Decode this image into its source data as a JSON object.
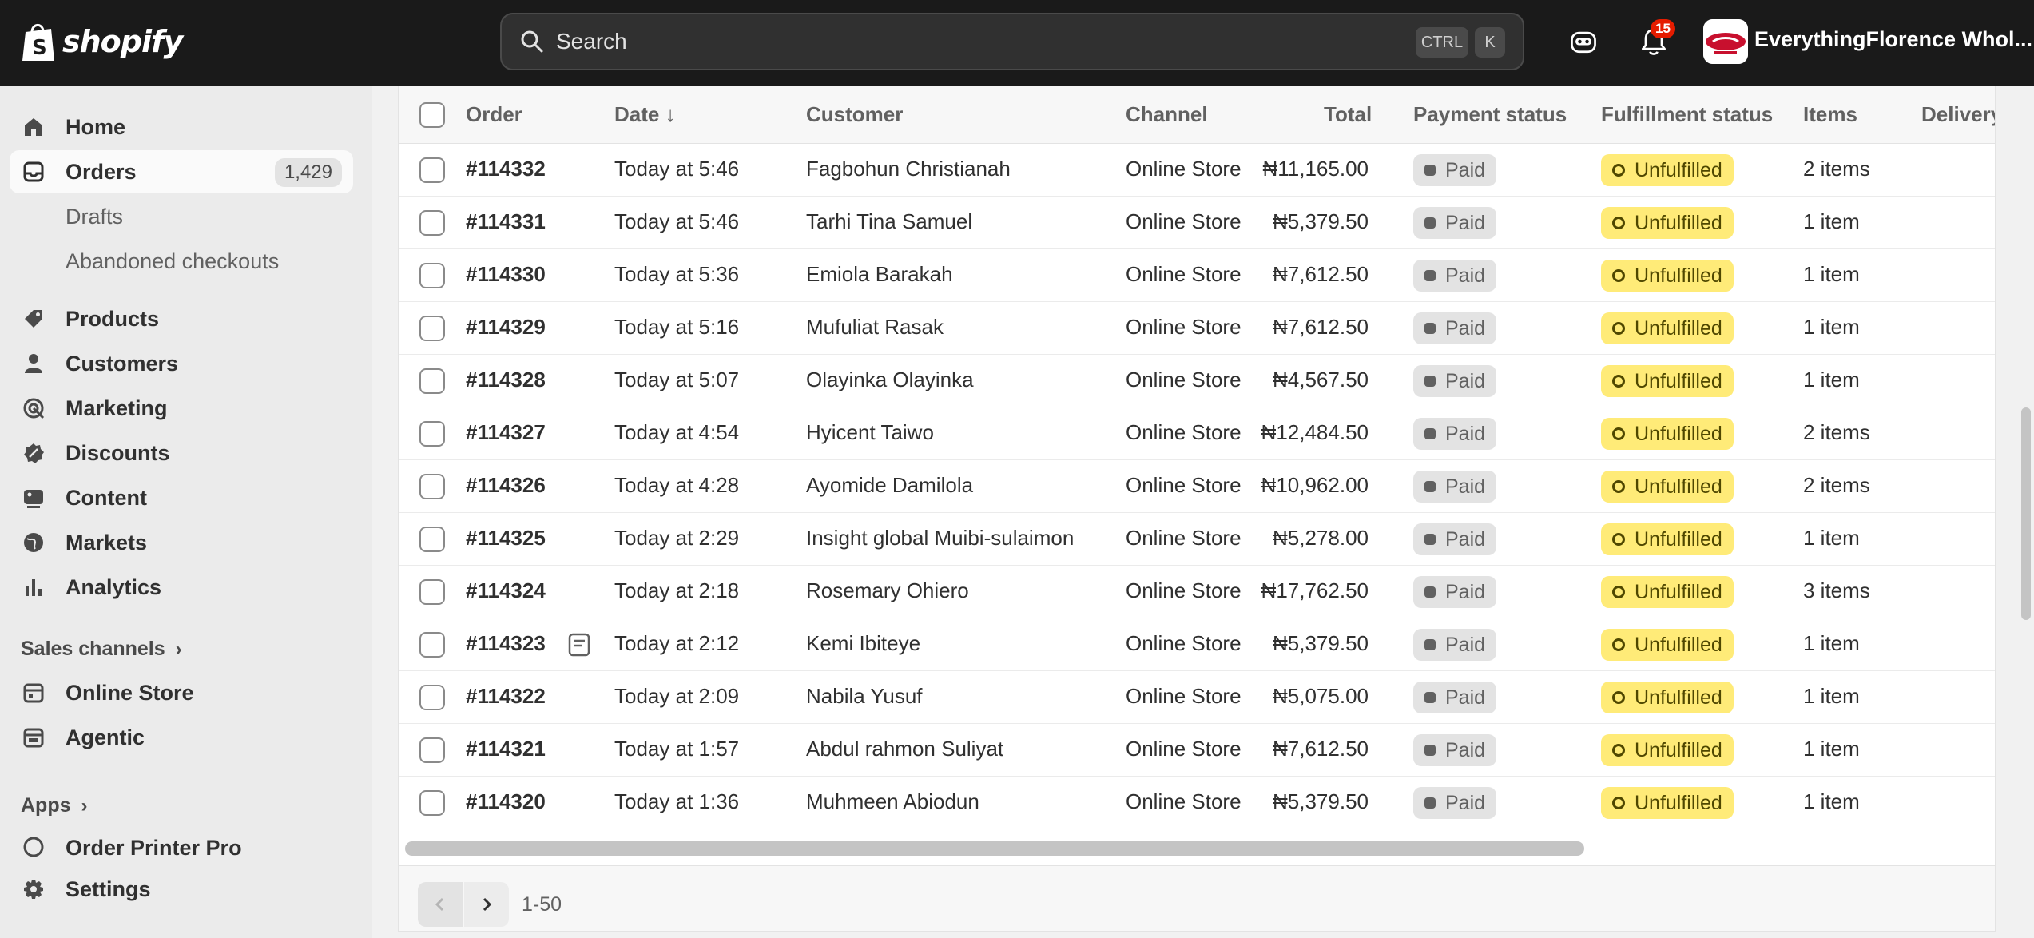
{
  "topbar": {
    "brand": "shopify",
    "search_label": "Search",
    "shortcut_ctrl": "CTRL",
    "shortcut_k": "K",
    "notifications_count": "15",
    "store_name": "EverythingFlorence Whol..."
  },
  "sidebar": {
    "home": "Home",
    "orders": "Orders",
    "orders_count": "1,429",
    "drafts": "Drafts",
    "abandoned": "Abandoned checkouts",
    "products": "Products",
    "customers": "Customers",
    "marketing": "Marketing",
    "discounts": "Discounts",
    "content": "Content",
    "markets": "Markets",
    "analytics": "Analytics",
    "sales_channels": "Sales channels",
    "online_store": "Online Store",
    "agentic": "Agentic",
    "apps": "Apps",
    "order_printer": "Order Printer Pro",
    "settings": "Settings"
  },
  "table": {
    "headers": {
      "order": "Order",
      "date": "Date",
      "customer": "Customer",
      "channel": "Channel",
      "total": "Total",
      "payment": "Payment status",
      "fulfillment": "Fulfillment status",
      "items": "Items",
      "delivery": "Delivery"
    },
    "rows": [
      {
        "order": "#114332",
        "date": "Today at 5:46",
        "customer": "Fagbohun Christianah",
        "channel": "Online Store",
        "total": "₦11,165.00",
        "payment": "Paid",
        "fulfillment": "Unfulfilled",
        "items": "2 items"
      },
      {
        "order": "#114331",
        "date": "Today at 5:46",
        "customer": "Tarhi Tina Samuel",
        "channel": "Online Store",
        "total": "₦5,379.50",
        "payment": "Paid",
        "fulfillment": "Unfulfilled",
        "items": "1 item"
      },
      {
        "order": "#114330",
        "date": "Today at 5:36",
        "customer": "Emiola Barakah",
        "channel": "Online Store",
        "total": "₦7,612.50",
        "payment": "Paid",
        "fulfillment": "Unfulfilled",
        "items": "1 item"
      },
      {
        "order": "#114329",
        "date": "Today at 5:16",
        "customer": "Mufuliat Rasak",
        "channel": "Online Store",
        "total": "₦7,612.50",
        "payment": "Paid",
        "fulfillment": "Unfulfilled",
        "items": "1 item"
      },
      {
        "order": "#114328",
        "date": "Today at 5:07",
        "customer": "Olayinka Olayinka",
        "channel": "Online Store",
        "total": "₦4,567.50",
        "payment": "Paid",
        "fulfillment": "Unfulfilled",
        "items": "1 item"
      },
      {
        "order": "#114327",
        "date": "Today at 4:54",
        "customer": "Hyicent Taiwo",
        "channel": "Online Store",
        "total": "₦12,484.50",
        "payment": "Paid",
        "fulfillment": "Unfulfilled",
        "items": "2 items"
      },
      {
        "order": "#114326",
        "date": "Today at 4:28",
        "customer": "Ayomide Damilola",
        "channel": "Online Store",
        "total": "₦10,962.00",
        "payment": "Paid",
        "fulfillment": "Unfulfilled",
        "items": "2 items"
      },
      {
        "order": "#114325",
        "date": "Today at 2:29",
        "customer": "Insight global Muibi-sulaimon",
        "channel": "Online Store",
        "total": "₦5,278.00",
        "payment": "Paid",
        "fulfillment": "Unfulfilled",
        "items": "1 item"
      },
      {
        "order": "#114324",
        "date": "Today at 2:18",
        "customer": "Rosemary Ohiero",
        "channel": "Online Store",
        "total": "₦17,762.50",
        "payment": "Paid",
        "fulfillment": "Unfulfilled",
        "items": "3 items"
      },
      {
        "order": "#114323",
        "date": "Today at 2:12",
        "customer": "Kemi Ibiteye",
        "channel": "Online Store",
        "total": "₦5,379.50",
        "payment": "Paid",
        "fulfillment": "Unfulfilled",
        "items": "1 item",
        "has_note": true
      },
      {
        "order": "#114322",
        "date": "Today at 2:09",
        "customer": "Nabila Yusuf",
        "channel": "Online Store",
        "total": "₦5,075.00",
        "payment": "Paid",
        "fulfillment": "Unfulfilled",
        "items": "1 item"
      },
      {
        "order": "#114321",
        "date": "Today at 1:57",
        "customer": "Abdul rahmon Suliyat",
        "channel": "Online Store",
        "total": "₦7,612.50",
        "payment": "Paid",
        "fulfillment": "Unfulfilled",
        "items": "1 item"
      },
      {
        "order": "#114320",
        "date": "Today at 1:36",
        "customer": "Muhmeen Abiodun",
        "channel": "Online Store",
        "total": "₦5,379.50",
        "payment": "Paid",
        "fulfillment": "Unfulfilled",
        "items": "1 item"
      }
    ]
  },
  "pagination": {
    "range": "1-50"
  },
  "colors": {
    "topbar": "#1a1a1a",
    "unfulfilled_badge": "#ffeb78",
    "paid_badge": "#e3e3e3",
    "notification_badge": "#e51c00"
  }
}
